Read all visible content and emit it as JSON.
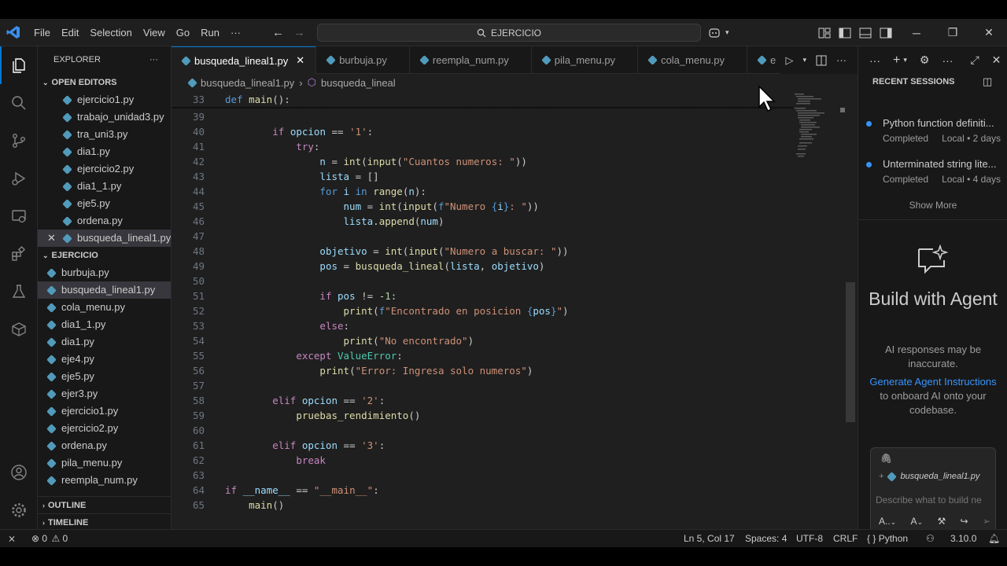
{
  "menu": [
    "File",
    "Edit",
    "Selection",
    "View",
    "Go",
    "Run",
    "···"
  ],
  "search": "EJERCICIO",
  "explorer": {
    "title": "EXPLORER",
    "open_editors_label": "OPEN EDITORS",
    "open_editors": [
      "ejercicio1.py",
      "trabajo_unidad3.py",
      "tra_uni3.py",
      "dia1.py",
      "ejercicio2.py",
      "dia1_1.py",
      "eje5.py",
      "ordena.py",
      "busqueda_lineal1.py"
    ],
    "folder_label": "EJERCICIO",
    "files": [
      "burbuja.py",
      "busqueda_lineal1.py",
      "cola_menu.py",
      "dia1_1.py",
      "dia1.py",
      "eje4.py",
      "eje5.py",
      "ejer3.py",
      "ejercicio1.py",
      "ejercicio2.py",
      "ordena.py",
      "pila_menu.py",
      "reempla_num.py"
    ],
    "outline_label": "OUTLINE",
    "timeline_label": "TIMELINE"
  },
  "tabs": [
    "busqueda_lineal1.py",
    "burbuja.py",
    "reempla_num.py",
    "pila_menu.py",
    "cola_menu.py",
    "e"
  ],
  "breadcrumb": {
    "file": "busqueda_lineal1.py",
    "symbol": "busqueda_lineal"
  },
  "code_lines": [
    {
      "n": "33",
      "code": "def main():"
    },
    {
      "n": "39",
      "code": ""
    },
    {
      "n": "40",
      "code": "        if opcion == '1':"
    },
    {
      "n": "41",
      "code": "            try:"
    },
    {
      "n": "42",
      "code": "                n = int(input(\"Cuantos numeros: \"))"
    },
    {
      "n": "43",
      "code": "                lista = []"
    },
    {
      "n": "44",
      "code": "                for i in range(n):"
    },
    {
      "n": "45",
      "code": "                    num = int(input(f\"Numero {i}: \"))"
    },
    {
      "n": "46",
      "code": "                    lista.append(num)"
    },
    {
      "n": "47",
      "code": ""
    },
    {
      "n": "48",
      "code": "                objetivo = int(input(\"Numero a buscar: \"))"
    },
    {
      "n": "49",
      "code": "                pos = busqueda_lineal(lista, objetivo)"
    },
    {
      "n": "50",
      "code": ""
    },
    {
      "n": "51",
      "code": "                if pos != -1:"
    },
    {
      "n": "52",
      "code": "                    print(f\"Encontrado en posicion {pos}\")"
    },
    {
      "n": "53",
      "code": "                else:"
    },
    {
      "n": "54",
      "code": "                    print(\"No encontrado\")"
    },
    {
      "n": "55",
      "code": "            except ValueError:"
    },
    {
      "n": "56",
      "code": "                print(\"Error: Ingresa solo numeros\")"
    },
    {
      "n": "57",
      "code": ""
    },
    {
      "n": "58",
      "code": "        elif opcion == '2':"
    },
    {
      "n": "59",
      "code": "            pruebas_rendimiento()"
    },
    {
      "n": "60",
      "code": ""
    },
    {
      "n": "61",
      "code": "        elif opcion == '3':"
    },
    {
      "n": "62",
      "code": "            break"
    },
    {
      "n": "63",
      "code": ""
    },
    {
      "n": "64",
      "code": "if __name__ == \"__main__\":"
    },
    {
      "n": "65",
      "code": "    main()"
    }
  ],
  "chat": {
    "recent_label": "RECENT SESSIONS",
    "sessions": [
      {
        "name": "Python function definiti...",
        "status": "Completed",
        "meta": "Local • 2 days"
      },
      {
        "name": "Unterminated string lite...",
        "status": "Completed",
        "meta": "Local • 4 days"
      }
    ],
    "show_more": "Show More",
    "agent_title": "Build with Agent",
    "agent_note": "AI responses may be inaccurate.",
    "agent_link": "Generate Agent Instructions",
    "agent_link_rest": " to onboard AI onto your codebase.",
    "attachment": "busqueda_lineal1.py",
    "input_placeholder": "Describe what to build ne",
    "mode_1": "A..",
    "mode_2": "A"
  },
  "status": {
    "errors": "0",
    "warnings": "0",
    "position": "Ln 5, Col 17",
    "spaces": "Spaces: 4",
    "encoding": "UTF-8",
    "eol": "CRLF",
    "language": "Python",
    "version": "3.10.0"
  }
}
